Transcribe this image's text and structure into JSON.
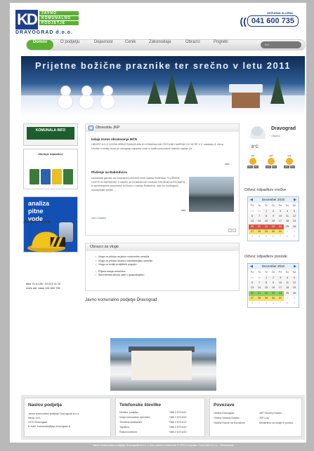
{
  "header": {
    "logo_letters": "KD",
    "logo_words": [
      "JAVNO",
      "KOMUNALNO",
      "PODJETJE"
    ],
    "logo_sub": "DRAVOGRAD d.o.o.",
    "phone_label": "DEŽURNA SLUŽBA",
    "phone_number": "041 600 735"
  },
  "nav": {
    "items": [
      "Domov",
      "O podjetju",
      "Dejavnost",
      "Cenik",
      "Zakonodaja",
      "Obrazci",
      "Pogrebi"
    ],
    "search_placeholder": "išči"
  },
  "banner": {
    "text": "Prijetne božične praznike ter srečno v letu 2011"
  },
  "left": {
    "komunala_title": "KOMUNALA INFO",
    "bins_title": "Zbiranje odpadkov",
    "analiza_lines": [
      "analiza",
      "pitne",
      "vode"
    ],
    "okvir_title": "Javljanje okvar",
    "okvir_lines": [
      "Med 7h in 15h : 02 872 11 10",
      "Izven del. časa: 041 600 735"
    ]
  },
  "news": {
    "title": "Obvestila JKP",
    "items": [
      {
        "heading": "Izdaja ocene obratovanja MČN",
        "text": "OBVESTILO O OCENI OBRATOVANJA MALIH KOMUNALNIH ČISTILNIH NAPRAV DO 50 PE V 2. odstavku 8. člena Uredbe o emisiji snovi pri odvajanju odpadne vode iz malih komunalnih čistilnih naprav (Ur ...",
        "more": "več..."
      },
      {
        "heading": "Pluženje na Rabindvoru",
        "text": "Uporabniki garnišč na enoznamni prometni cesti naselja Robindvor PLUŽENJE CESTE IN PARKIRIŠČ V NASELJU ROBINDVOR ZARADI KROŽNEGA PROMETA S spremenjenim prometnim režimom v naselju Robindvor, nam bo koriščajoču dostopnejše službe ...",
        "more": "več."
      }
    ],
    "all_link": "Vse v Novice",
    "pager": [
      "<",
      ">"
    ]
  },
  "vloge": {
    "title": "Obrazci za vloge",
    "group1": [
      "Vloga za priklop na javno vodovodno omrežje",
      "Vloga za priklop na javno kanalizacijsko omrežje",
      "Vloga za izdajo projektnih pogojev"
    ],
    "group2": [
      "Prijava stanja vodomera",
      "Sprememba števila oseb v gospodinjstvu"
    ]
  },
  "jkp": {
    "title": "Javno komunalno podjetje Dravograd"
  },
  "weather": {
    "location": "Dravograd",
    "condition": "Oblačno",
    "temp": "8°C",
    "forecast": [
      {
        "day": "čet",
        "lo": "3°C",
        "hi": "8°C"
      },
      {
        "day": "pet",
        "lo": "2°C",
        "hi": "6°C"
      },
      {
        "day": "sob",
        "lo": "2°C",
        "hi": "7°C"
      }
    ]
  },
  "calendars": [
    {
      "title": "Odvoz odpadkov vrečke",
      "month": "December 2010",
      "days": [
        "Po",
        "To",
        "Sr",
        "Če",
        "Pe",
        "So",
        "Ne"
      ],
      "rows": [
        [
          "29",
          "30",
          "1",
          "2",
          "3",
          "4",
          "5"
        ],
        [
          "6",
          "7",
          "8",
          "9",
          "10",
          "11",
          "12"
        ],
        [
          "13",
          "14",
          "15",
          "16",
          "17",
          "18",
          "19"
        ],
        [
          "20",
          "21",
          "22",
          "23",
          "24",
          "25",
          "26"
        ],
        [
          "27",
          "28",
          "29",
          "30",
          "31",
          "1",
          "2"
        ],
        [
          "3",
          "4",
          "5",
          "6",
          "7",
          "8",
          "9"
        ]
      ]
    },
    {
      "title": "Odvoz odpadkov posode",
      "month": "December 2010",
      "days": [
        "Po",
        "To",
        "Sr",
        "Če",
        "Pe",
        "So",
        "Ne"
      ],
      "rows": [
        [
          "29",
          "30",
          "1",
          "2",
          "3",
          "4",
          "5"
        ],
        [
          "6",
          "7",
          "8",
          "9",
          "10",
          "11",
          "12"
        ],
        [
          "13",
          "14",
          "15",
          "16",
          "17",
          "18",
          "19"
        ],
        [
          "20",
          "21",
          "22",
          "23",
          "24",
          "25",
          "26"
        ],
        [
          "27",
          "28",
          "29",
          "30",
          "31",
          "1",
          "2"
        ],
        [
          "3",
          "4",
          "5",
          "6",
          "7",
          "8",
          "9"
        ]
      ]
    }
  ],
  "footer": {
    "naslov": {
      "title": "Naslov podjetja",
      "lines": [
        "Javno komunalno podjetje Dravograd d.o.o.",
        "Meža 143,",
        "2370 Dravograd",
        "E-mail: komunala@jkp-dravograd.si"
      ]
    },
    "telefon": {
      "title": "Telefonske številke",
      "rows": [
        [
          "Direktor podjetja:",
          "+386 2 8721111"
        ],
        [
          "Vodja komunalne operative:",
          "+386 2 8721113"
        ],
        [
          "Tehnična sodelavka:",
          "+386 2 8721121"
        ],
        [
          "Tajništvo:",
          "+386 2 8721110"
        ],
        [
          "Računovodstvo:",
          "+386 2 8721115"
        ]
      ]
    },
    "povezave": {
      "title": "Povezave",
      "col1": [
        "Občina Dravograd",
        "Občina Slovenj Gradec",
        "Občina Ravne na Koroškem"
      ],
      "col2": [
        "JKP Slovenj Gradec",
        "JKP Log",
        "Ministrstvo za okolje in prostor"
      ]
    }
  },
  "copyright": "Javno komunalno podjetje Dravograd d.o.o. | Vse pravice pridržane © 2010 Izvedba: TrueCAD d.o.o. - Panorama",
  "colors": {
    "brand_green": "#5bb032",
    "brand_blue": "#1e3f8a"
  }
}
